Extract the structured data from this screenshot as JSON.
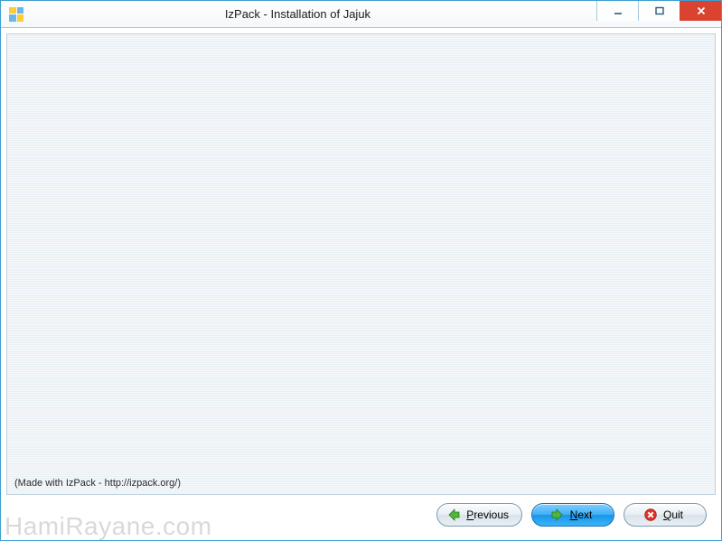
{
  "titlebar": {
    "title": "IzPack - Installation of Jajuk"
  },
  "footer": {
    "credit": "(Made with IzPack - http://izpack.org/)"
  },
  "buttons": {
    "previous": {
      "label": "Previous",
      "mnemonic": "P"
    },
    "next": {
      "label": "Next",
      "mnemonic": "N"
    },
    "quit": {
      "label": "Quit",
      "mnemonic": "Q"
    }
  },
  "icons": {
    "previous": "arrow-left-icon",
    "next": "arrow-right-icon",
    "quit": "close-circle-icon"
  },
  "watermark": "HamiRayane.com"
}
